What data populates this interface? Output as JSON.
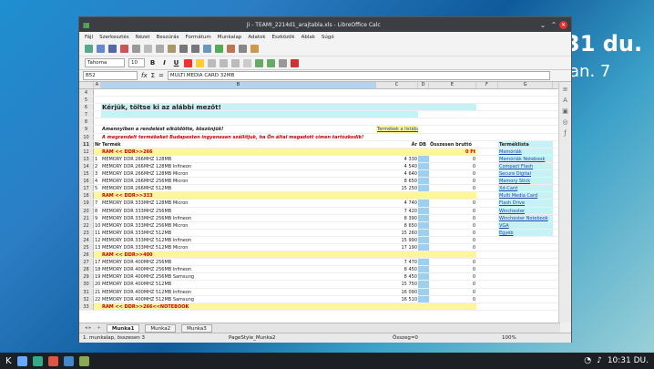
{
  "desktop": {
    "time": "31 du.",
    "date": "jan. 7"
  },
  "window": {
    "title": "Ji - TEAMI_2214d1_arajtabla.xls - LibreOffice Calc"
  },
  "menu": [
    "Fájl",
    "Szerkesztés",
    "Nézet",
    "Beszúrás",
    "Formátum",
    "Munkalap",
    "Adatok",
    "Eszközök",
    "Ablak",
    "Súgó"
  ],
  "format": {
    "font": "Tahoma",
    "size": "10",
    "bold": "B",
    "italic": "I",
    "underline": "U"
  },
  "formula": {
    "cellref": "B52",
    "content": "MULTI MEDIA CARD 32MB"
  },
  "columns": [
    "A",
    "B",
    "C",
    "D",
    "E",
    "F",
    "G"
  ],
  "banner": {
    "title": "Kérjük, töltse ki az alábbi mezőt!",
    "note1": "Amennyiben a rendelést elküldötte, köszönjük!",
    "note2": "A megrendelt termékeket Budapesten ingyenesen szállítjuk, ha Ön által megadott címen tartózkodik!",
    "link": "Termékek a listában"
  },
  "headers": {
    "nr": "Nr",
    "termek": "Termék",
    "ar": "Ár",
    "db": "DB",
    "osszesen": "Összesen bruttó"
  },
  "sections": [
    {
      "row": "12",
      "label": "RAM << DDR>>266",
      "total": "0 Ft"
    },
    {
      "row": "18",
      "label": "RAM << DDR>>333"
    },
    {
      "row": "26",
      "label": "RAM << DDR>>400"
    },
    {
      "row": "33",
      "label": "RAM << DDR>>266<<NOTEBOOK"
    }
  ],
  "rows": [
    {
      "rn": "13",
      "nr": "1",
      "name": "MEMORY DDR 266MHZ 128MB",
      "brand": "",
      "price": "4 330",
      "total": "0"
    },
    {
      "rn": "14",
      "nr": "2",
      "name": "MEMORY DDR 266MHZ 128MB",
      "brand": "Infineon",
      "price": "4 540",
      "total": "0"
    },
    {
      "rn": "15",
      "nr": "3",
      "name": "MEMORY DDR 266MHZ 128MB",
      "brand": "Micron",
      "price": "4 640",
      "total": "0"
    },
    {
      "rn": "16",
      "nr": "4",
      "name": "MEMORY DDR 266MHZ 256MB",
      "brand": "Micron",
      "price": "8 650",
      "total": "0"
    },
    {
      "rn": "17",
      "nr": "5",
      "name": "MEMORY DDR 266MHZ 512MB",
      "brand": "",
      "price": "15 250",
      "total": "0"
    },
    {
      "rn": "19",
      "nr": "7",
      "name": "MEMORY DDR 333MHZ 128MB",
      "brand": "Micron",
      "price": "4 740",
      "total": "0"
    },
    {
      "rn": "20",
      "nr": "8",
      "name": "MEMORY DDR 333MHZ 256MB",
      "brand": "",
      "price": "7 420",
      "total": "0"
    },
    {
      "rn": "21",
      "nr": "9",
      "name": "MEMORY DDR 333MHZ 256MB",
      "brand": "Infineon",
      "price": "8 390",
      "total": "0"
    },
    {
      "rn": "22",
      "nr": "10",
      "name": "MEMORY DDR 333MHZ 256MB",
      "brand": "Micron",
      "price": "8 650",
      "total": "0"
    },
    {
      "rn": "23",
      "nr": "11",
      "name": "MEMORY DDR 333MHZ 512MB",
      "brand": "",
      "price": "15 260",
      "total": "0"
    },
    {
      "rn": "24",
      "nr": "12",
      "name": "MEMORY DDR 333MHZ 512MB",
      "brand": "Infineon",
      "price": "15 990",
      "total": "0"
    },
    {
      "rn": "25",
      "nr": "13",
      "name": "MEMORY DDR 333MHZ 512MB",
      "brand": "Micron",
      "price": "17 190",
      "total": "0"
    },
    {
      "rn": "27",
      "nr": "17",
      "name": "MEMORY DDR 400MHZ 256MB",
      "brand": "",
      "price": "7 470",
      "total": "0"
    },
    {
      "rn": "28",
      "nr": "18",
      "name": "MEMORY DDR 400MHZ 256MB",
      "brand": "Infineon",
      "price": "8 450",
      "total": "0"
    },
    {
      "rn": "29",
      "nr": "19",
      "name": "MEMORY DDR 400MHZ 256MB",
      "brand": "Samsung",
      "price": "8 450",
      "total": "0"
    },
    {
      "rn": "30",
      "nr": "20",
      "name": "MEMORY DDR 400MHZ 512MB",
      "brand": "",
      "price": "15 750",
      "total": "0"
    },
    {
      "rn": "31",
      "nr": "21",
      "name": "MEMORY DDR 400MHZ 512MB",
      "brand": "Infineon",
      "price": "16 090",
      "total": "0"
    },
    {
      "rn": "32",
      "nr": "22",
      "name": "MEMORY DDR 400MHZ 512MB",
      "brand": "Samsung",
      "price": "16 510",
      "total": "0"
    }
  ],
  "categories": {
    "title": "Terméklista",
    "items": [
      "Memóriák",
      "Memóriák Notebook",
      "Compact Flash",
      "Secure Digital",
      "Memory Stick",
      "Xd-Card",
      "Multi Media Card",
      "Flash Drive",
      "Winchester",
      "Winchester Notebook",
      "VGA",
      "Egyéb"
    ]
  },
  "sheets": [
    "Munka1",
    "Munka2",
    "Munka3"
  ],
  "active_sheet": "Munka1",
  "status": {
    "left": "1. munkalap, összesen 3",
    "mid": "PageStyle_Munka2",
    "right": "Összeg=0",
    "zoom": "100%"
  },
  "taskbar": {
    "time": "10:31 DU."
  }
}
